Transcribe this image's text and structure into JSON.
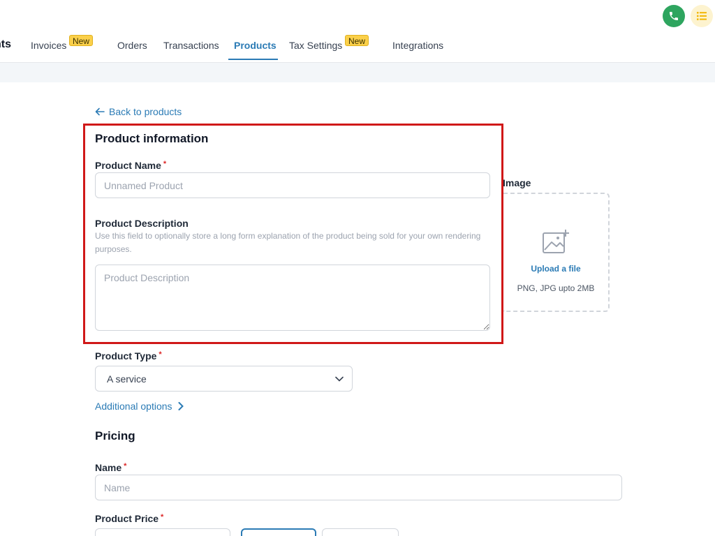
{
  "nav": {
    "cut_text": "nts",
    "tabs": [
      {
        "label": "Invoices",
        "badge": "New"
      },
      {
        "label": "Orders"
      },
      {
        "label": "Transactions"
      },
      {
        "label": "Products"
      },
      {
        "label": "Tax Settings",
        "badge": "New"
      },
      {
        "label": "Integrations"
      }
    ],
    "active_tab": "Products",
    "icons": [
      "phone-icon",
      "list-icon"
    ]
  },
  "page": {
    "back_link": "Back to products",
    "product_info": {
      "title": "Product information",
      "name_label": "Product Name",
      "required_mark": "*",
      "name_placeholder": "Unnamed Product",
      "name_value": "",
      "description_label": "Product Description",
      "description_help": "Use this field to optionally store a long form explanation of the product being sold for your own rendering purposes.",
      "description_placeholder": "Product Description",
      "description_value": ""
    },
    "image": {
      "label": "Image",
      "upload_text": "Upload a file",
      "hint": "PNG, JPG upto 2MB"
    },
    "product_type": {
      "label": "Product Type",
      "selected": "A service"
    },
    "additional_options": "Additional options",
    "pricing": {
      "title": "Pricing",
      "name_label": "Name",
      "name_placeholder": "Name",
      "price_label": "Product Price"
    }
  },
  "colors": {
    "accent": "#2b7bb5",
    "highlight_border": "#d01818",
    "badge": "#fbd04a",
    "phone_button": "#2ea55f"
  }
}
